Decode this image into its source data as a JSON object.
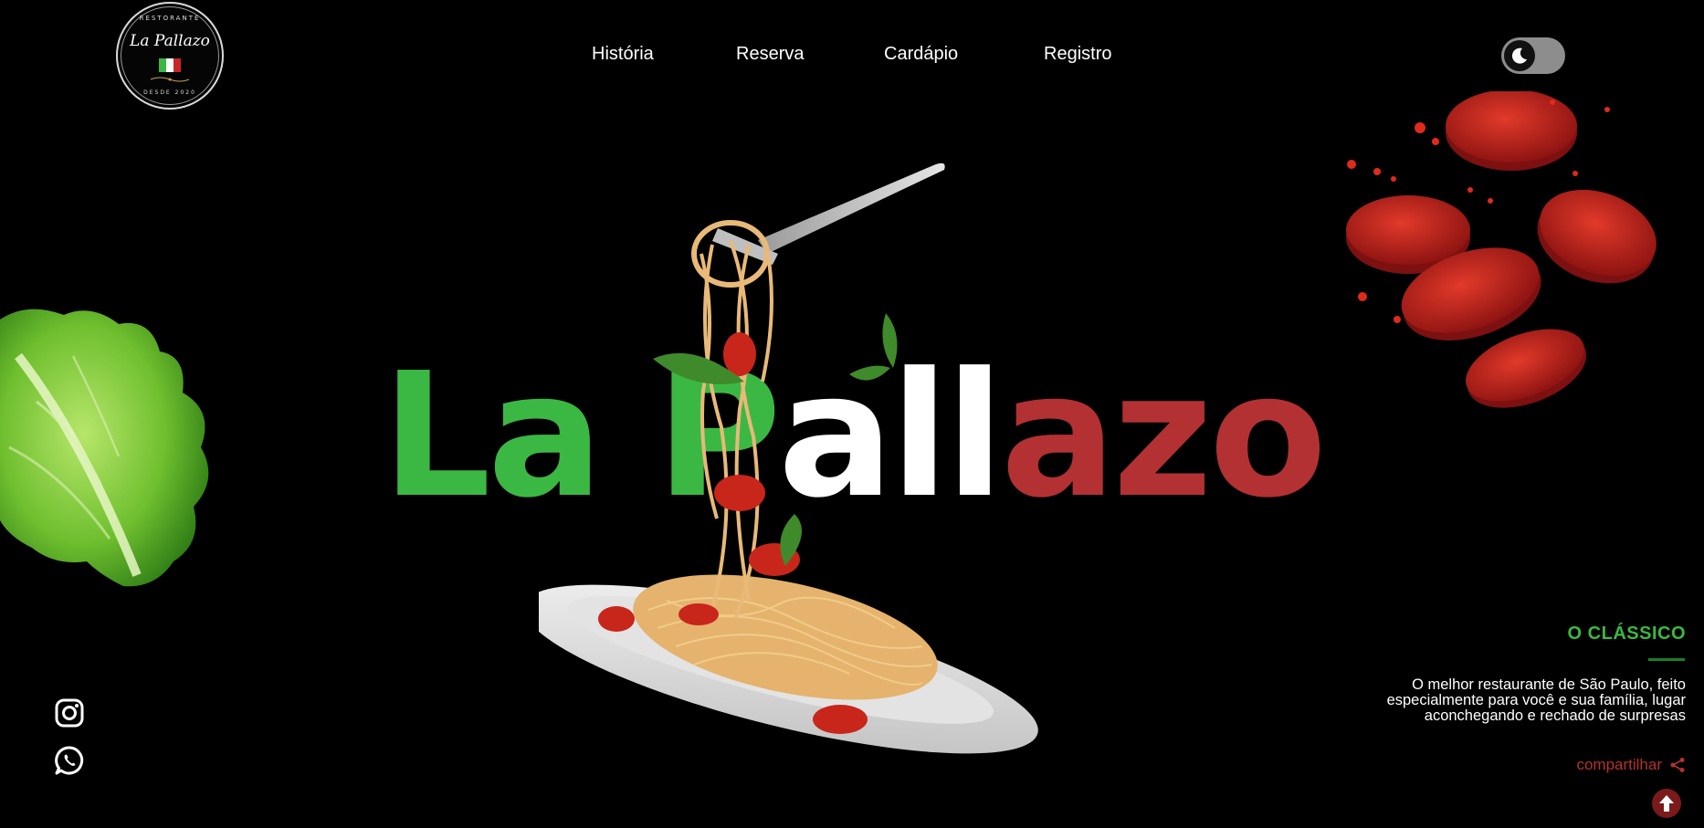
{
  "brand": {
    "logo_top": "RESTORANTE",
    "logo_name": "La Pallazo",
    "logo_bottom": "DESDE 2020",
    "flag_colors": [
      "#3bb843",
      "#ffffff",
      "#c8262b"
    ]
  },
  "nav": {
    "items": [
      {
        "label": "História"
      },
      {
        "label": "Reserva"
      },
      {
        "label": "Cardápio"
      },
      {
        "label": "Registro"
      }
    ]
  },
  "theme_toggle": {
    "icon": "moon-icon",
    "mode": "dark"
  },
  "hero": {
    "title_parts": [
      {
        "text": "La P",
        "color": "#3bb843"
      },
      {
        "text": "all",
        "color": "#ffffff"
      },
      {
        "text": "azo",
        "color": "#b33132"
      }
    ]
  },
  "feature": {
    "title": "O CLÁSSICO",
    "description": "O melhor restaurante de São Paulo, feito especialmente para você e sua família, lugar aconchegando e rechado de surpresas",
    "share_label": "compartilhar"
  },
  "social": {
    "icons": [
      "instagram-icon",
      "whatsapp-icon"
    ]
  },
  "colors": {
    "accent_green": "#3bb843",
    "accent_red": "#b33132",
    "background": "#000000"
  }
}
